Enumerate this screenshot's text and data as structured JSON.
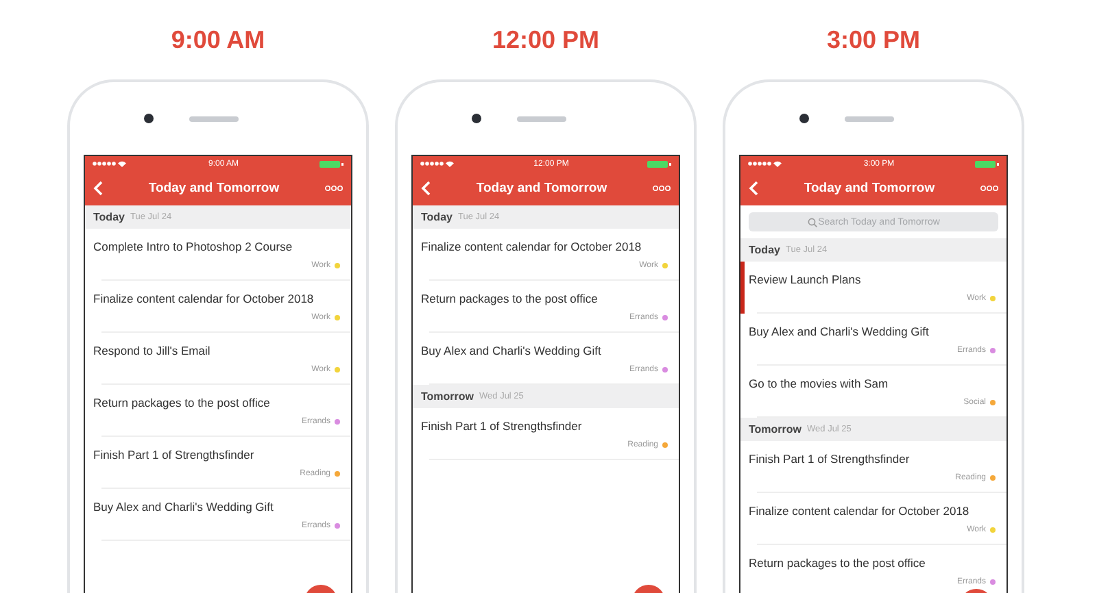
{
  "phones": [
    {
      "heading": "9:00 AM",
      "status_time": "9:00 AM",
      "nav_title": "Today and Tomorrow",
      "sections": [
        {
          "label": "Today",
          "date": "Tue Jul 24",
          "tasks": [
            {
              "title": "Complete Intro to Photoshop 2 Course",
              "tag": "Work",
              "color": "#f2d43c",
              "selected": false
            },
            {
              "title": "Finalize content calendar for October 2018",
              "tag": "Work",
              "color": "#f2d43c",
              "selected": false
            },
            {
              "title": "Respond to Jill's Email",
              "tag": "Work",
              "color": "#f2d43c",
              "selected": false
            },
            {
              "title": "Return packages to the post office",
              "tag": "Errands",
              "color": "#d98ce0",
              "selected": false
            },
            {
              "title": "Finish Part 1 of Strengthsfinder",
              "tag": "Reading",
              "color": "#f5a83a",
              "selected": false
            },
            {
              "title": "Buy Alex and Charli's Wedding Gift",
              "tag": "Errands",
              "color": "#d98ce0",
              "selected": false
            }
          ]
        }
      ]
    },
    {
      "heading": "12:00 PM",
      "status_time": "12:00 PM",
      "nav_title": "Today and Tomorrow",
      "sections": [
        {
          "label": "Today",
          "date": "Tue Jul 24",
          "tasks": [
            {
              "title": "Finalize content calendar for October 2018",
              "tag": "Work",
              "color": "#f2d43c",
              "selected": false
            },
            {
              "title": "Return packages to the post office",
              "tag": "Errands",
              "color": "#d98ce0",
              "selected": false
            },
            {
              "title": "Buy Alex and Charli's Wedding Gift",
              "tag": "Errands",
              "color": "#d98ce0",
              "selected": false
            }
          ]
        },
        {
          "label": "Tomorrow",
          "date": "Wed Jul 25",
          "tasks": [
            {
              "title": "Finish Part 1 of Strengthsfinder",
              "tag": "Reading",
              "color": "#f5a83a",
              "selected": false
            }
          ]
        }
      ]
    },
    {
      "heading": "3:00 PM",
      "status_time": "3:00 PM",
      "nav_title": "Today and Tomorrow",
      "search": {
        "placeholder": "Search Today and Tomorrow"
      },
      "sections": [
        {
          "label": "Today",
          "date": "Tue Jul 24",
          "tasks": [
            {
              "title": "Review Launch Plans",
              "tag": "Work",
              "color": "#f2d43c",
              "selected": true
            },
            {
              "title": "Buy Alex and Charli's Wedding Gift",
              "tag": "Errands",
              "color": "#d98ce0",
              "selected": false
            },
            {
              "title": "Go to the movies with Sam",
              "tag": "Social",
              "color": "#f5a83a",
              "selected": false
            }
          ]
        },
        {
          "label": "Tomorrow",
          "date": "Wed Jul 25",
          "tasks": [
            {
              "title": "Finish Part 1 of Strengthsfinder",
              "tag": "Reading",
              "color": "#f5a83a",
              "selected": false
            },
            {
              "title": "Finalize content calendar for October 2018",
              "tag": "Work",
              "color": "#f2d43c",
              "selected": false
            },
            {
              "title": "Return packages to the post office",
              "tag": "Errands",
              "color": "#d98ce0",
              "selected": false
            }
          ]
        }
      ]
    }
  ]
}
